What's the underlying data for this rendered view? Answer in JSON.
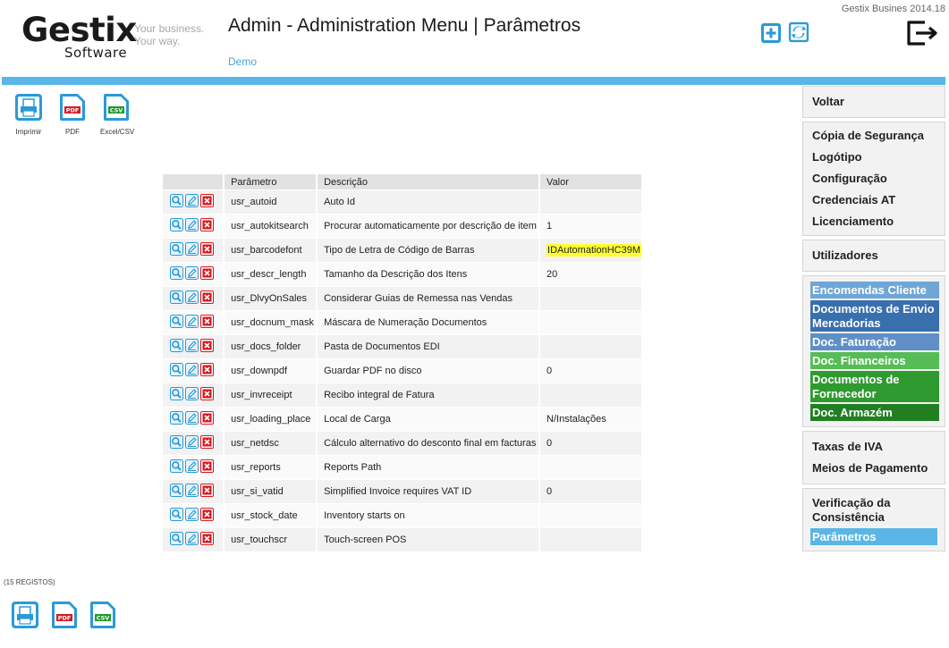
{
  "header": {
    "logo_main": "Gestix",
    "logo_sub": "Software",
    "logo_tagline_1": "Your business.",
    "logo_tagline_2": "Your way.",
    "title": "Admin - Administration Menu | Parâmetros",
    "subtitle": "Demo",
    "version": "Gestix Busines 2014.18",
    "icons": [
      "add-icon",
      "sync-icon",
      "logout-icon"
    ]
  },
  "toolbar": {
    "print_label": "Imprimir",
    "pdf_label": "PDF",
    "csv_label": "Excel/CSV",
    "pdf_badge": "PDF",
    "csv_badge": "CSV"
  },
  "table": {
    "columns": [
      "",
      "Parâmetro",
      "Descrição",
      "Valor"
    ],
    "rows": [
      {
        "param": "usr_autoid",
        "desc": "Auto Id",
        "value": ""
      },
      {
        "param": "usr_autokitsearch",
        "desc": "Procurar automaticamente por descrição de item",
        "value": "1"
      },
      {
        "param": "usr_barcodefont",
        "desc": "Tipo de Letra de Código de Barras",
        "value": "IDAutomationHC39M"
      },
      {
        "param": "usr_descr_length",
        "desc": "Tamanho da Descrição dos Itens",
        "value": "20"
      },
      {
        "param": "usr_DlvyOnSales",
        "desc": "Considerar Guias de Remessa nas Vendas",
        "value": ""
      },
      {
        "param": "usr_docnum_mask",
        "desc": "Máscara de Numeração Documentos",
        "value": ""
      },
      {
        "param": "usr_docs_folder",
        "desc": "Pasta de Documentos EDI",
        "value": ""
      },
      {
        "param": "usr_downpdf",
        "desc": "Guardar PDF no disco",
        "value": "0"
      },
      {
        "param": "usr_invreceipt",
        "desc": "Recibo integral de Fatura",
        "value": ""
      },
      {
        "param": "usr_loading_place",
        "desc": "Local de Carga",
        "value": "N/Instalações"
      },
      {
        "param": "usr_netdsc",
        "desc": "Cálculo alternativo do desconto final em facturas",
        "value": "0"
      },
      {
        "param": "usr_reports",
        "desc": "Reports Path",
        "value": ""
      },
      {
        "param": "usr_si_vatid",
        "desc": "Simplified Invoice requires VAT ID",
        "value": "0"
      },
      {
        "param": "usr_stock_date",
        "desc": "Inventory starts on",
        "value": ""
      },
      {
        "param": "usr_touchscr",
        "desc": "Touch-screen POS",
        "value": ""
      }
    ]
  },
  "record_count": "(15 REGISTOS)",
  "sidebar": {
    "back": "Voltar",
    "group1": [
      "Cópia de Segurança",
      "Logótipo",
      "Configuração",
      "Credenciais AT",
      "Licenciamento"
    ],
    "users": "Utilizadores",
    "modules": [
      "Encomendas Cliente",
      "Documentos de Envio Mercadorias",
      "Doc. Faturação",
      "Doc. Financeiros",
      "Documentos de Fornecedor",
      "Doc. Armazém"
    ],
    "group3": [
      "Taxas de IVA",
      "Meios de Pagamento"
    ],
    "group4": [
      "Verificação da Consistência",
      "Parâmetros"
    ]
  },
  "colors": {
    "accent": "#59b6e6",
    "highlight": "#ffff33",
    "delete": "#d9181f"
  }
}
